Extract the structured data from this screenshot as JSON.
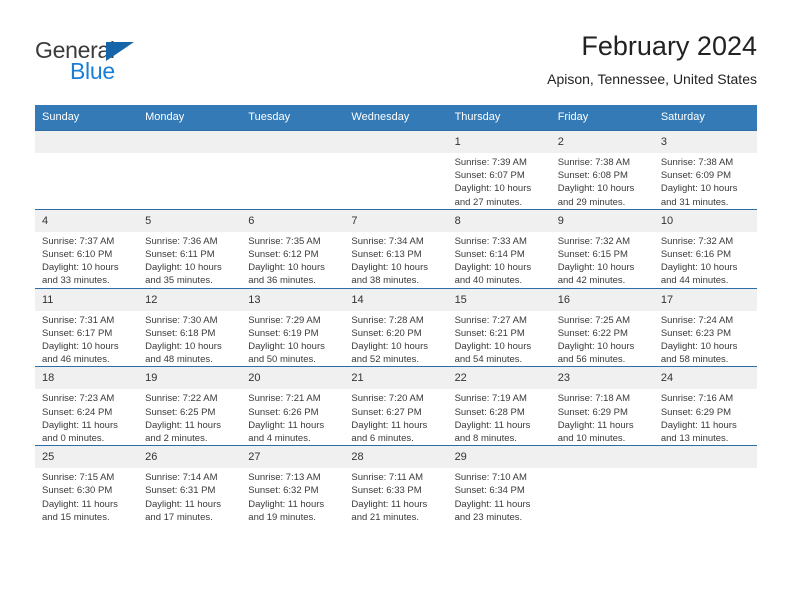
{
  "brand": {
    "name_part1": "General",
    "name_part2": "Blue",
    "triangle_color": "#1565a8",
    "blue_color": "#1a7fd4"
  },
  "header": {
    "title": "February 2024",
    "subtitle": "Apison, Tennessee, United States"
  },
  "theme": {
    "header_bg": "#337ab7",
    "row_divider": "#2e6da4",
    "daynum_bg": "#f0f0f0"
  },
  "columns": [
    "Sunday",
    "Monday",
    "Tuesday",
    "Wednesday",
    "Thursday",
    "Friday",
    "Saturday"
  ],
  "labels": {
    "sunrise": "Sunrise:",
    "sunset": "Sunset:",
    "daylight": "Daylight:"
  },
  "weeks": [
    [
      {
        "day": "",
        "sunrise": "",
        "sunset": "",
        "daylight": ""
      },
      {
        "day": "",
        "sunrise": "",
        "sunset": "",
        "daylight": ""
      },
      {
        "day": "",
        "sunrise": "",
        "sunset": "",
        "daylight": ""
      },
      {
        "day": "",
        "sunrise": "",
        "sunset": "",
        "daylight": ""
      },
      {
        "day": "1",
        "sunrise": "Sunrise: 7:39 AM",
        "sunset": "Sunset: 6:07 PM",
        "daylight": "Daylight: 10 hours and 27 minutes."
      },
      {
        "day": "2",
        "sunrise": "Sunrise: 7:38 AM",
        "sunset": "Sunset: 6:08 PM",
        "daylight": "Daylight: 10 hours and 29 minutes."
      },
      {
        "day": "3",
        "sunrise": "Sunrise: 7:38 AM",
        "sunset": "Sunset: 6:09 PM",
        "daylight": "Daylight: 10 hours and 31 minutes."
      }
    ],
    [
      {
        "day": "4",
        "sunrise": "Sunrise: 7:37 AM",
        "sunset": "Sunset: 6:10 PM",
        "daylight": "Daylight: 10 hours and 33 minutes."
      },
      {
        "day": "5",
        "sunrise": "Sunrise: 7:36 AM",
        "sunset": "Sunset: 6:11 PM",
        "daylight": "Daylight: 10 hours and 35 minutes."
      },
      {
        "day": "6",
        "sunrise": "Sunrise: 7:35 AM",
        "sunset": "Sunset: 6:12 PM",
        "daylight": "Daylight: 10 hours and 36 minutes."
      },
      {
        "day": "7",
        "sunrise": "Sunrise: 7:34 AM",
        "sunset": "Sunset: 6:13 PM",
        "daylight": "Daylight: 10 hours and 38 minutes."
      },
      {
        "day": "8",
        "sunrise": "Sunrise: 7:33 AM",
        "sunset": "Sunset: 6:14 PM",
        "daylight": "Daylight: 10 hours and 40 minutes."
      },
      {
        "day": "9",
        "sunrise": "Sunrise: 7:32 AM",
        "sunset": "Sunset: 6:15 PM",
        "daylight": "Daylight: 10 hours and 42 minutes."
      },
      {
        "day": "10",
        "sunrise": "Sunrise: 7:32 AM",
        "sunset": "Sunset: 6:16 PM",
        "daylight": "Daylight: 10 hours and 44 minutes."
      }
    ],
    [
      {
        "day": "11",
        "sunrise": "Sunrise: 7:31 AM",
        "sunset": "Sunset: 6:17 PM",
        "daylight": "Daylight: 10 hours and 46 minutes."
      },
      {
        "day": "12",
        "sunrise": "Sunrise: 7:30 AM",
        "sunset": "Sunset: 6:18 PM",
        "daylight": "Daylight: 10 hours and 48 minutes."
      },
      {
        "day": "13",
        "sunrise": "Sunrise: 7:29 AM",
        "sunset": "Sunset: 6:19 PM",
        "daylight": "Daylight: 10 hours and 50 minutes."
      },
      {
        "day": "14",
        "sunrise": "Sunrise: 7:28 AM",
        "sunset": "Sunset: 6:20 PM",
        "daylight": "Daylight: 10 hours and 52 minutes."
      },
      {
        "day": "15",
        "sunrise": "Sunrise: 7:27 AM",
        "sunset": "Sunset: 6:21 PM",
        "daylight": "Daylight: 10 hours and 54 minutes."
      },
      {
        "day": "16",
        "sunrise": "Sunrise: 7:25 AM",
        "sunset": "Sunset: 6:22 PM",
        "daylight": "Daylight: 10 hours and 56 minutes."
      },
      {
        "day": "17",
        "sunrise": "Sunrise: 7:24 AM",
        "sunset": "Sunset: 6:23 PM",
        "daylight": "Daylight: 10 hours and 58 minutes."
      }
    ],
    [
      {
        "day": "18",
        "sunrise": "Sunrise: 7:23 AM",
        "sunset": "Sunset: 6:24 PM",
        "daylight": "Daylight: 11 hours and 0 minutes."
      },
      {
        "day": "19",
        "sunrise": "Sunrise: 7:22 AM",
        "sunset": "Sunset: 6:25 PM",
        "daylight": "Daylight: 11 hours and 2 minutes."
      },
      {
        "day": "20",
        "sunrise": "Sunrise: 7:21 AM",
        "sunset": "Sunset: 6:26 PM",
        "daylight": "Daylight: 11 hours and 4 minutes."
      },
      {
        "day": "21",
        "sunrise": "Sunrise: 7:20 AM",
        "sunset": "Sunset: 6:27 PM",
        "daylight": "Daylight: 11 hours and 6 minutes."
      },
      {
        "day": "22",
        "sunrise": "Sunrise: 7:19 AM",
        "sunset": "Sunset: 6:28 PM",
        "daylight": "Daylight: 11 hours and 8 minutes."
      },
      {
        "day": "23",
        "sunrise": "Sunrise: 7:18 AM",
        "sunset": "Sunset: 6:29 PM",
        "daylight": "Daylight: 11 hours and 10 minutes."
      },
      {
        "day": "24",
        "sunrise": "Sunrise: 7:16 AM",
        "sunset": "Sunset: 6:29 PM",
        "daylight": "Daylight: 11 hours and 13 minutes."
      }
    ],
    [
      {
        "day": "25",
        "sunrise": "Sunrise: 7:15 AM",
        "sunset": "Sunset: 6:30 PM",
        "daylight": "Daylight: 11 hours and 15 minutes."
      },
      {
        "day": "26",
        "sunrise": "Sunrise: 7:14 AM",
        "sunset": "Sunset: 6:31 PM",
        "daylight": "Daylight: 11 hours and 17 minutes."
      },
      {
        "day": "27",
        "sunrise": "Sunrise: 7:13 AM",
        "sunset": "Sunset: 6:32 PM",
        "daylight": "Daylight: 11 hours and 19 minutes."
      },
      {
        "day": "28",
        "sunrise": "Sunrise: 7:11 AM",
        "sunset": "Sunset: 6:33 PM",
        "daylight": "Daylight: 11 hours and 21 minutes."
      },
      {
        "day": "29",
        "sunrise": "Sunrise: 7:10 AM",
        "sunset": "Sunset: 6:34 PM",
        "daylight": "Daylight: 11 hours and 23 minutes."
      },
      {
        "day": "",
        "sunrise": "",
        "sunset": "",
        "daylight": ""
      },
      {
        "day": "",
        "sunrise": "",
        "sunset": "",
        "daylight": ""
      }
    ]
  ]
}
